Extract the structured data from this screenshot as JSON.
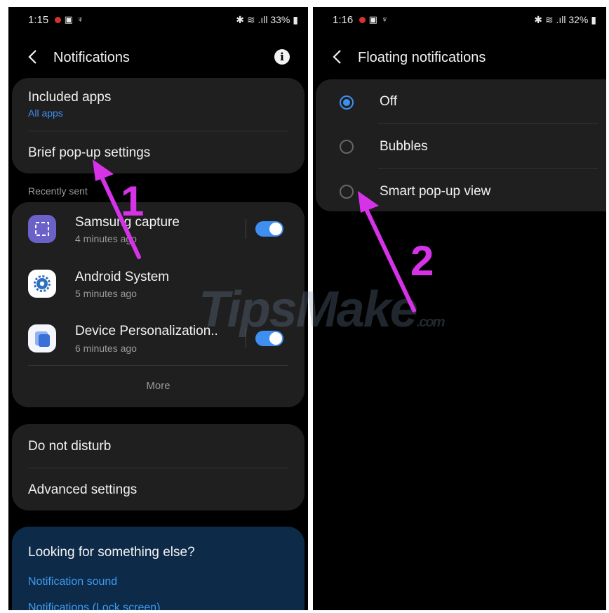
{
  "left": {
    "status": {
      "time": "1:15",
      "battery": "33%"
    },
    "header": {
      "title": "Notifications"
    },
    "card1": {
      "included_apps": "Included apps",
      "all_apps": "All apps",
      "brief_popup": "Brief pop-up settings"
    },
    "recently_sent_label": "Recently sent",
    "apps": [
      {
        "name": "Samsung capture",
        "time": "4 minutes ago",
        "toggle": true
      },
      {
        "name": "Android System",
        "time": "5 minutes ago",
        "toggle": false
      },
      {
        "name": "Device Personalization..",
        "time": "6 minutes ago",
        "toggle": true
      }
    ],
    "more_label": "More",
    "card3": {
      "dnd": "Do not disturb",
      "advanced": "Advanced settings"
    },
    "blue_card": {
      "title": "Looking for something else?",
      "links": [
        "Notification sound",
        "Notifications (Lock screen)"
      ]
    }
  },
  "right": {
    "status": {
      "time": "1:16",
      "battery": "32%"
    },
    "header": {
      "title": "Floating notifications"
    },
    "options": [
      {
        "label": "Off",
        "selected": true
      },
      {
        "label": "Bubbles",
        "selected": false
      },
      {
        "label": "Smart pop-up view",
        "selected": false
      }
    ]
  },
  "annotations": {
    "step1": "1",
    "step2": "2"
  },
  "watermark": {
    "main": "TipsMake",
    "suffix": ".com"
  },
  "colors": {
    "accent": "#3e8ff0",
    "card": "#1f1f1f",
    "annotation": "#d633e8",
    "blue_card": "#0d2b49"
  }
}
